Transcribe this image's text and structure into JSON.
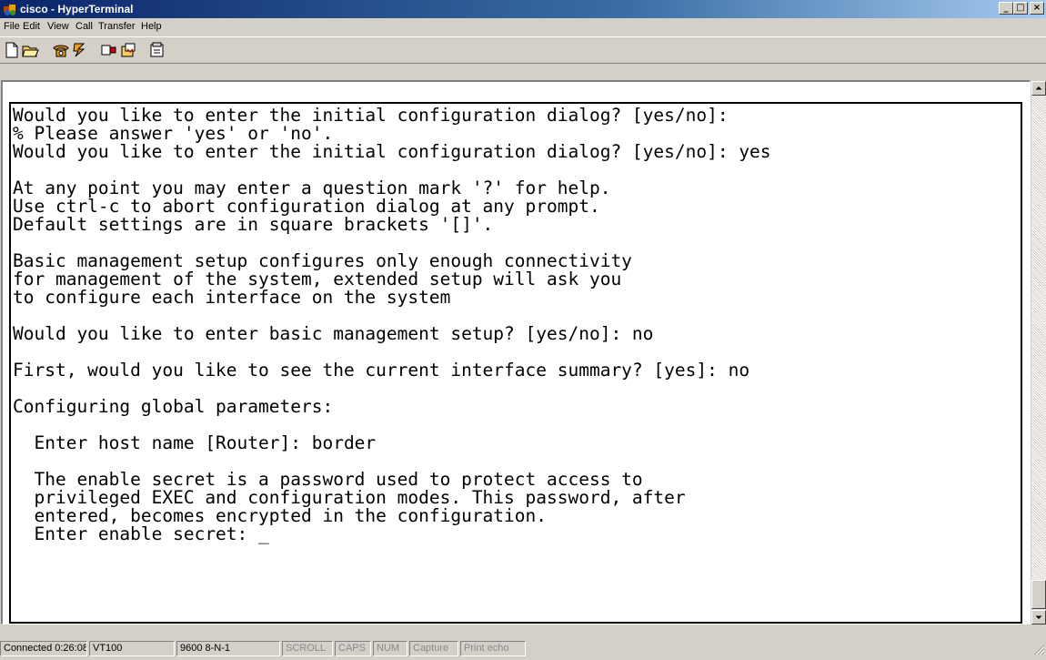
{
  "window": {
    "title": "cisco - HyperTerminal",
    "icon": "hyperterminal-app-icon",
    "controls": {
      "minimize": "_",
      "maximize": "□",
      "close": "×"
    }
  },
  "menu": {
    "items": [
      {
        "label": "File"
      },
      {
        "label": "Edit"
      },
      {
        "label": "View"
      },
      {
        "label": "Call"
      },
      {
        "label": "Transfer"
      },
      {
        "label": "Help"
      }
    ]
  },
  "toolbar": {
    "buttons": [
      {
        "icon": "new-file-icon"
      },
      {
        "icon": "open-folder-icon"
      },
      {
        "icon": "connect-phone-icon"
      },
      {
        "icon": "disconnect-phone-icon"
      },
      {
        "icon": "send-file-icon"
      },
      {
        "icon": "receive-file-icon"
      },
      {
        "icon": "properties-icon"
      }
    ]
  },
  "terminal": {
    "lines": [
      "Would you like to enter the initial configuration dialog? [yes/no]: ",
      "% Please answer 'yes' or 'no'.",
      "Would you like to enter the initial configuration dialog? [yes/no]: yes",
      "",
      "At any point you may enter a question mark '?' for help.",
      "Use ctrl-c to abort configuration dialog at any prompt.",
      "Default settings are in square brackets '[]'.",
      "",
      "Basic management setup configures only enough connectivity",
      "for management of the system, extended setup will ask you",
      "to configure each interface on the system",
      "",
      "Would you like to enter basic management setup? [yes/no]: no",
      "",
      "First, would you like to see the current interface summary? [yes]: no",
      "",
      "Configuring global parameters:",
      "",
      "  Enter host name [Router]: border",
      "",
      "  The enable secret is a password used to protect access to",
      "  privileged EXEC and configuration modes. This password, after",
      "  entered, becomes encrypted in the configuration.",
      "  Enter enable secret: _"
    ]
  },
  "status": {
    "connected": "Connected 0:26:08",
    "emulation": "VT100",
    "port": "9600 8-N-1",
    "scroll": "SCROLL",
    "caps": "CAPS",
    "num": "NUM",
    "capture": "Capture",
    "print_echo": "Print echo"
  },
  "colors": {
    "title_gradient_start": "#0a246a",
    "title_gradient_end": "#a6caf0",
    "chrome": "#d4d0c8",
    "terminal_bg": "#ffffff",
    "terminal_text": "#000000"
  }
}
